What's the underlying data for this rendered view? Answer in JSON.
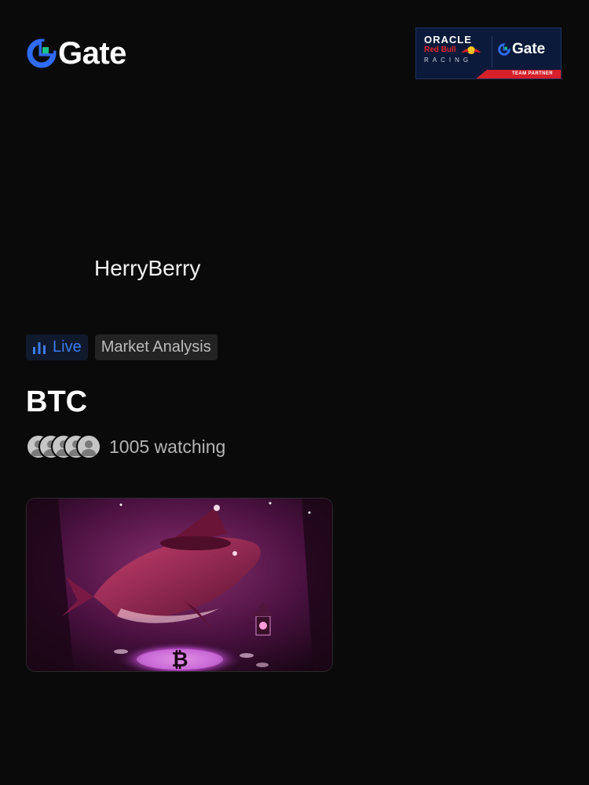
{
  "brand": {
    "logo_text": "Gate",
    "accent": "#2f6bf3",
    "accent_green": "#19c286"
  },
  "partner": {
    "oracle": "ORACLE",
    "redbull": "Red Bull",
    "racing": "RACING",
    "gate_text": "Gate",
    "badge": "TEAM PARTNER"
  },
  "host": {
    "name": "HerryBerry"
  },
  "tags": {
    "live_label": "Live",
    "category_label": "Market Analysis"
  },
  "stream": {
    "title": "BTC",
    "watching_text": "1005 watching",
    "avatar_count": 5,
    "thumbnail_icon": "bitcoin-whale-thumbnail"
  },
  "colors": {
    "background": "#0a0a0a",
    "live_text": "#3b7cf2",
    "muted_text": "#b5b5b5"
  }
}
